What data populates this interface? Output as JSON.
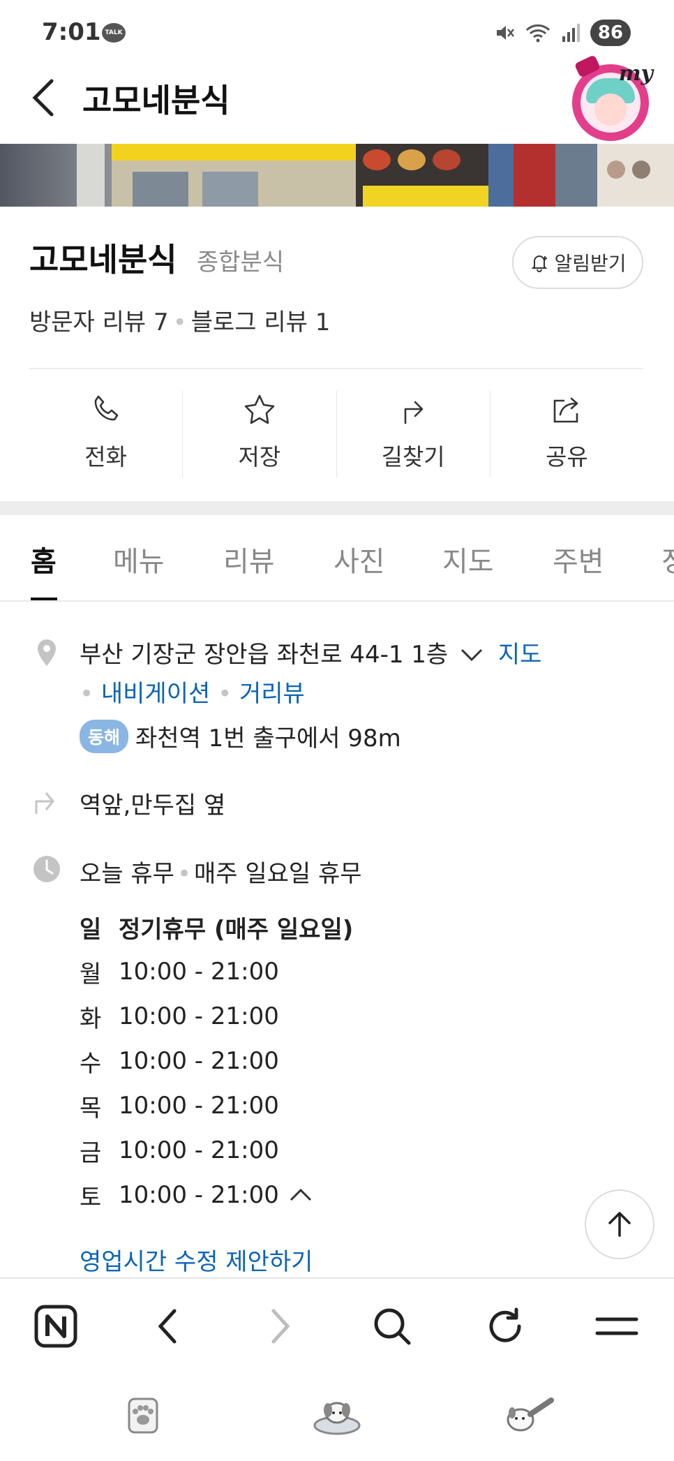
{
  "status": {
    "time": "7:01",
    "talk": "TALK",
    "battery": "86"
  },
  "header": {
    "title": "고모네분식",
    "avatar_text": "my"
  },
  "place": {
    "name": "고모네분식",
    "category": "종합분식",
    "alarm_label": "알림받기",
    "visitor_reviews": "방문자 리뷰 7",
    "blog_reviews": "블로그 리뷰 1"
  },
  "actions": [
    {
      "label": "전화",
      "icon": "phone-icon"
    },
    {
      "label": "저장",
      "icon": "star-icon"
    },
    {
      "label": "길찾기",
      "icon": "directions-icon"
    },
    {
      "label": "공유",
      "icon": "share-icon"
    }
  ],
  "tabs": [
    "홈",
    "메뉴",
    "리뷰",
    "사진",
    "지도",
    "주변",
    "정"
  ],
  "details": {
    "address": "부산 기장군 장안읍 좌천로 44-1 1층",
    "map_link": "지도",
    "navigation_link": "내비게이션",
    "streetview_link": "거리뷰",
    "subway_badge": "동해",
    "subway_text": "좌천역 1번 출구에서 98m",
    "direction_text": "역앞,만두집 옆",
    "today_status": "오늘 휴무",
    "today_note": "매주 일요일 휴무",
    "hours": [
      {
        "day": "일",
        "time": "정기휴무 (매주 일요일)"
      },
      {
        "day": "월",
        "time": "10:00 - 21:00"
      },
      {
        "day": "화",
        "time": "10:00 - 21:00"
      },
      {
        "day": "수",
        "time": "10:00 - 21:00"
      },
      {
        "day": "목",
        "time": "10:00 - 21:00"
      },
      {
        "day": "금",
        "time": "10:00 - 21:00"
      },
      {
        "day": "토",
        "time": "10:00 - 21:00"
      }
    ],
    "suggest_edit": "영업시간 수정 제안하기"
  },
  "colors": {
    "link": "#0b64b8",
    "badge": "#8ab6e3",
    "accent": "#111111"
  }
}
